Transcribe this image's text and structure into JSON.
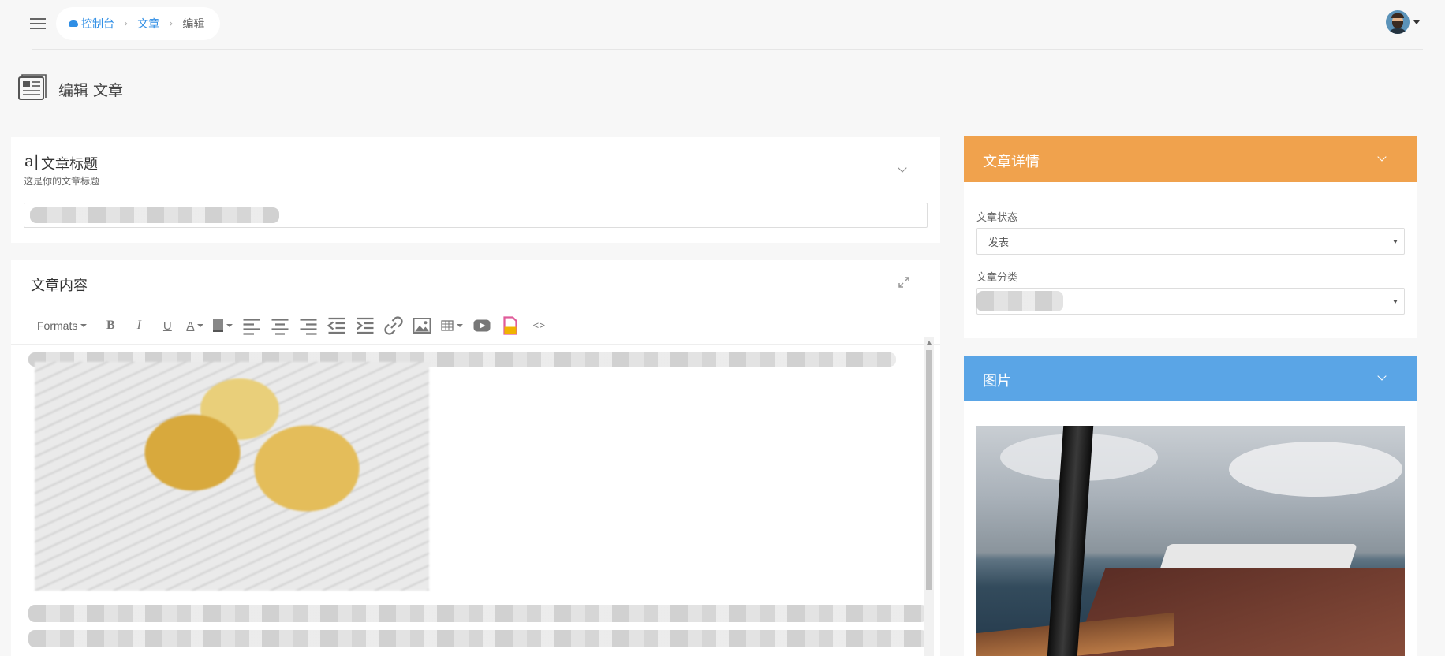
{
  "breadcrumb": {
    "items": [
      {
        "label": "控制台",
        "icon": "cloud-icon"
      },
      {
        "label": "文章"
      },
      {
        "label": "编辑"
      }
    ]
  },
  "page": {
    "title": "编辑 文章",
    "icon": "newspaper-icon"
  },
  "title_card": {
    "icon_text": "a|",
    "heading": "文章标题",
    "subheading": "这是你的文章标题"
  },
  "content_card": {
    "heading": "文章内容",
    "toolbar": {
      "formats_label": "Formats",
      "buttons": [
        "bold-icon",
        "italic-icon",
        "underline-icon",
        "font-color-icon",
        "background-color-icon",
        "align-left-icon",
        "align-center-icon",
        "align-right-icon",
        "outdent-icon",
        "indent-icon",
        "link-icon",
        "image-icon",
        "table-icon",
        "video-icon",
        "paste-icon",
        "code-icon"
      ]
    }
  },
  "details": {
    "header": "文章详情",
    "status_label": "文章状态",
    "status_value": "发表",
    "category_label": "文章分类",
    "category_value": ""
  },
  "image_panel": {
    "header": "图片"
  },
  "colors": {
    "accent_blue": "#2f8ee5",
    "details_header": "#f0a24d",
    "image_header": "#5aa5e6",
    "page_bg": "#f7f7f7"
  }
}
